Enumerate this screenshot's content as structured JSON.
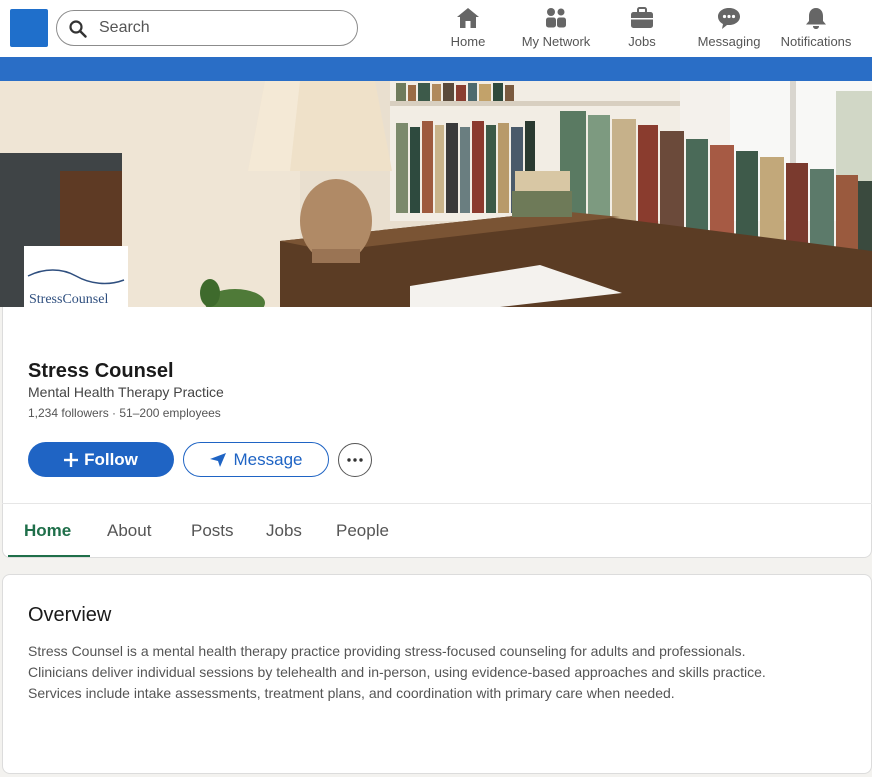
{
  "nav": {
    "search_placeholder": "Search",
    "items": [
      {
        "label": "Home",
        "icon": "home-icon"
      },
      {
        "label": "My Network",
        "icon": "network-icon"
      },
      {
        "label": "Jobs",
        "icon": "briefcase-icon"
      },
      {
        "label": "Messaging",
        "icon": "chat-icon"
      },
      {
        "label": "Notifications",
        "icon": "bell-icon"
      }
    ]
  },
  "colors": {
    "brand_blue": "#1f64c4",
    "stripe_blue": "#2a6ec6",
    "tab_active": "#1f6f4a"
  },
  "company": {
    "logo_text": "StressCounsel",
    "name": "Stress Counsel",
    "tagline": "Mental Health Therapy Practice",
    "meta": "1,234 followers · 51–200 employees"
  },
  "actions": {
    "follow_label": "Follow",
    "message_label": "Message"
  },
  "tabs": [
    {
      "label": "Home",
      "active": true
    },
    {
      "label": "About",
      "active": false
    },
    {
      "label": "Posts",
      "active": false
    },
    {
      "label": "Jobs",
      "active": false
    },
    {
      "label": "People",
      "active": false
    }
  ],
  "overview": {
    "title": "Overview",
    "lines": [
      "Stress Counsel is a mental health therapy practice providing stress-focused counseling for adults and professionals.",
      "Clinicians deliver individual sessions by telehealth and in-person, using evidence-based approaches and skills practice.",
      "Services include intake assessments, treatment plans, and coordination with primary care when needed."
    ]
  }
}
